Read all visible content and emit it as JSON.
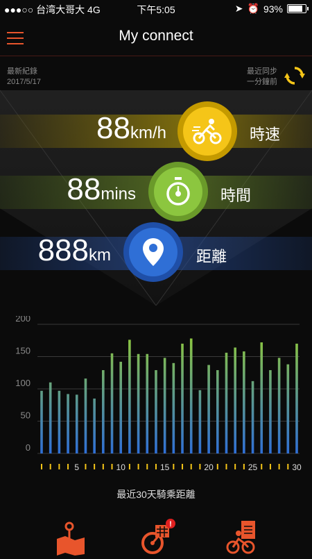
{
  "status": {
    "carrier": "●●●○○ 台湾大哥大  4G",
    "time": "下午5:05",
    "battery": "93%",
    "battery_level": 0.93
  },
  "nav": {
    "title": "My connect"
  },
  "record": {
    "label": "最新紀錄",
    "date": "2017/5/17"
  },
  "sync": {
    "label": "最近同步",
    "ago": "一分鐘前"
  },
  "metrics": {
    "speed": {
      "value": "88",
      "unit": "km/h",
      "label": "時速",
      "color": "#f5c518"
    },
    "time": {
      "value": "88",
      "unit": "mins",
      "label": "時間",
      "color": "#8cc63f"
    },
    "distance": {
      "value": "888",
      "unit": "km",
      "label": "距離",
      "color": "#2f6fd6"
    }
  },
  "chart_caption": "最近30天騎乘距離",
  "chart_data": {
    "type": "bar",
    "title": "",
    "xlabel": "",
    "ylabel": "",
    "ylim": [
      0,
      200
    ],
    "yticks": [
      0,
      50,
      100,
      150,
      200
    ],
    "xtick_labels": [
      "5",
      "10",
      "15",
      "20",
      "25",
      "30"
    ],
    "x": [
      1,
      2,
      3,
      4,
      5,
      6,
      7,
      8,
      9,
      10,
      11,
      12,
      13,
      14,
      15,
      16,
      17,
      18,
      19,
      20,
      21,
      22,
      23,
      24,
      25,
      26,
      27,
      28,
      29,
      30
    ],
    "values": [
      97,
      110,
      97,
      92,
      91,
      116,
      85,
      129,
      155,
      142,
      176,
      154,
      154,
      129,
      148,
      140,
      170,
      178,
      98,
      137,
      129,
      156,
      164,
      158,
      112,
      172,
      129,
      148,
      138,
      170
    ],
    "grid": true,
    "colors": {
      "bottom": "#2f6fd6",
      "top": "#8cc63f",
      "tick": "#f5c518"
    }
  },
  "tabs": [
    {
      "name": "map",
      "icon": "map-pin-icon"
    },
    {
      "name": "calendar-bike",
      "icon": "calendar-bike-icon",
      "badge": "!"
    },
    {
      "name": "rider-report",
      "icon": "rider-report-icon"
    }
  ],
  "accent": "#e8552c"
}
